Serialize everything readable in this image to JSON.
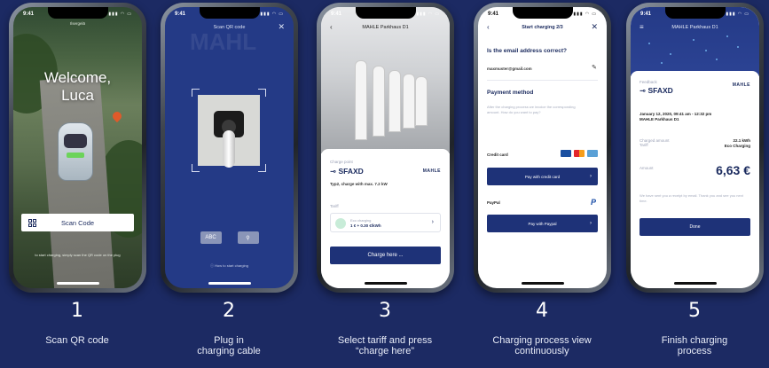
{
  "colors": {
    "background": "#1c2a63",
    "primary": "#1e3278",
    "brand_blue": "#243a86"
  },
  "screens": {
    "s1": {
      "time": "9:41",
      "top_text": "Ilsergelä",
      "greeting": "Welcome, Luca",
      "scan_button": "Scan Code",
      "hint": "to start charging, simply scan the QR code on the plug"
    },
    "s2": {
      "time": "9:41",
      "header": "Scan QR code",
      "close": "✕",
      "ghost": "MAHL",
      "btn1": "ABC",
      "btn2": "⚲",
      "howto": "How to start charging"
    },
    "s3": {
      "time": "9:41",
      "header": "MAHLE Parkhaus D1",
      "back": "‹",
      "chargepoint_label": "Charge point",
      "chargepoint_code": "SFAXD",
      "brand": "MAHLE",
      "type": "Typ2, charge with max. 7.2 kW",
      "tariff_label": "Tariff",
      "tariff_name": "Eco charging",
      "tariff_price": "1 € + 0.30 €/kWh",
      "cta": "Charge here ..."
    },
    "s4": {
      "time": "9:41",
      "header": "Start charging 2/3",
      "back": "‹",
      "close": "✕",
      "question": "Is the email address correct?",
      "email": "maxmuster@gmail.com",
      "payment_title": "Payment method",
      "payment_desc": "After the charging process we invoice the corresponding amount. How do you want to pay?",
      "credit_card": "Credit card",
      "pay_credit": "Pay with credit card",
      "paypal": "PayPal",
      "pay_paypal": "Pay with Paypal",
      "paypal_logo": "P"
    },
    "s5": {
      "time": "9:41",
      "header": "MAHLE Parkhaus D1",
      "menu": "≡",
      "feedback_label": "Feedback",
      "code": "SFAXD",
      "brand": "MAHLE",
      "date": "January 12, 2020, 09:41 am - 12:32 pm",
      "location": "MAHLE Parkhaus D1",
      "charged_label": "Charged amount",
      "charged_value": "22.1 kWh",
      "tariff_label": "Tariff",
      "tariff_value": "Eco Charging",
      "amount_label": "Amount",
      "amount_value": "6,63 €",
      "note": "We have sent you a receipt by email. Thank you and see you next time.",
      "done": "Done"
    }
  },
  "steps": [
    {
      "num": "1",
      "text": "Scan QR code"
    },
    {
      "num": "2",
      "text": "Plug in charging cable"
    },
    {
      "num": "3",
      "text": "Select tariff and press “charge here”"
    },
    {
      "num": "4",
      "text": "Charging process view continuously"
    },
    {
      "num": "5",
      "text": "Finish charging process"
    }
  ]
}
